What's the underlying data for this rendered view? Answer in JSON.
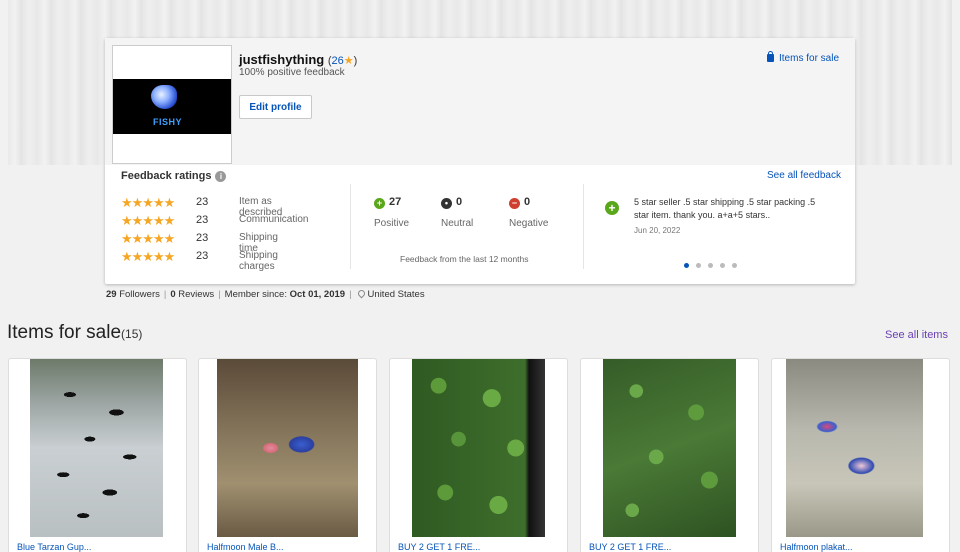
{
  "seller": {
    "name": "justfishything",
    "score_open": "(",
    "score": "26",
    "score_star": "★",
    "score_close": ")",
    "positive_feedback": "100% positive feedback",
    "edit_profile_label": "Edit profile",
    "items_for_sale_link": "Items for sale",
    "avatar_logo_text": "FISHY"
  },
  "feedback_ratings": {
    "title": "Feedback ratings",
    "see_all_label": "See all feedback",
    "detailed": [
      {
        "stars": "★★★★★",
        "count": "23",
        "label": "Item as described"
      },
      {
        "stars": "★★★★★",
        "count": "23",
        "label": "Communication"
      },
      {
        "stars": "★★★★★",
        "count": "23",
        "label": "Shipping time"
      },
      {
        "stars": "★★★★★",
        "count": "23",
        "label": "Shipping charges"
      }
    ],
    "counts": {
      "positive": {
        "icon": "+",
        "value": "27",
        "label": "Positive"
      },
      "neutral": {
        "icon": "•",
        "value": "0",
        "label": "Neutral"
      },
      "negative": {
        "icon": "−",
        "value": "0",
        "label": "Negative"
      }
    },
    "period_label": "Feedback from the last 12 months",
    "latest_comment": {
      "icon": "+",
      "text": "5 star seller .5 star shipping .5 star packing .5 star item. thank you. a+a+5 stars..",
      "date": "Jun 20, 2022"
    },
    "carousel": {
      "total": 5,
      "active": 1
    }
  },
  "stats": {
    "followers_count": "29",
    "followers_label": "Followers",
    "reviews_count": "0",
    "reviews_label": "Reviews",
    "member_since_label": "Member since:",
    "member_since": "Oct 01, 2019",
    "location": "United States"
  },
  "items_section": {
    "title": "Items for sale",
    "count": "(15)",
    "see_all_label": "See all items",
    "items": [
      {
        "title": "Blue Tarzan Gup..."
      },
      {
        "title": "Halfmoon Male B..."
      },
      {
        "title": "BUY 2 GET 1 FRE..."
      },
      {
        "title": "BUY 2 GET 1 FRE..."
      },
      {
        "title": "Halfmoon plakat..."
      }
    ]
  },
  "colors": {
    "link": "#0654ba",
    "star": "#f5a623",
    "positive": "#5ba71b",
    "negative": "#d0402f",
    "see_all_items": "#6a3fb3"
  }
}
